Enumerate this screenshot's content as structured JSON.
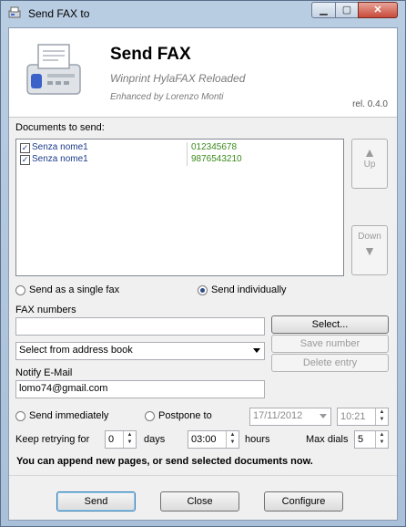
{
  "window": {
    "title": "Send FAX to"
  },
  "header": {
    "title": "Send FAX",
    "subtitle": "Winprint HylaFAX Reloaded",
    "credit": "Enhanced by Lorenzo Monti",
    "release": "rel. 0.4.0"
  },
  "documents": {
    "label": "Documents to send:",
    "items": [
      {
        "name": "Senza nome1",
        "number": "012345678",
        "checked": true
      },
      {
        "name": "Senza nome1",
        "number": "9876543210",
        "checked": true
      }
    ],
    "up_label": "Up",
    "down_label": "Down"
  },
  "send_mode": {
    "single_label": "Send as a single fax",
    "individual_label": "Send individually",
    "selected": "individually"
  },
  "fax_numbers": {
    "label": "FAX numbers",
    "value": "",
    "select_label": "Select...",
    "save_label": "Save number",
    "delete_label": "Delete entry",
    "address_book": "Select from address book"
  },
  "notify": {
    "label": "Notify E-Mail",
    "value": "lomo74@gmail.com"
  },
  "schedule": {
    "immediately_label": "Send immediately",
    "postpone_label": "Postpone to",
    "date": "17/11/2012",
    "time": "10:21"
  },
  "retry": {
    "keep_label": "Keep retrying for",
    "days_value": "0",
    "days_label": "days",
    "hours_value": "03:00",
    "hours_label": "hours",
    "maxdials_label": "Max dials",
    "maxdials_value": "5"
  },
  "message": "You can append new pages, or send selected documents now.",
  "buttons": {
    "send": "Send",
    "close": "Close",
    "configure": "Configure"
  }
}
